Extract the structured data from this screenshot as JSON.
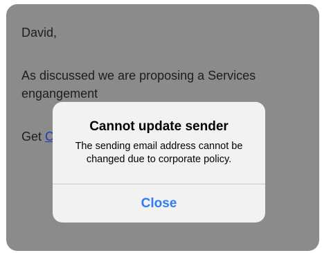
{
  "compose": {
    "greeting": "David,",
    "message": "As discussed we are proposing a Services engangement",
    "get_prefix": "Get ",
    "get_link_fragment": "C"
  },
  "alert": {
    "title": "Cannot update sender",
    "message": "The sending email address cannot be changed due to corporate policy.",
    "close_label": "Close"
  },
  "colors": {
    "dim_overlay": "#8b8b8b",
    "alert_background": "#f2f2f2",
    "button_accent": "#2f7cf6",
    "link": "#1a3fb0"
  }
}
